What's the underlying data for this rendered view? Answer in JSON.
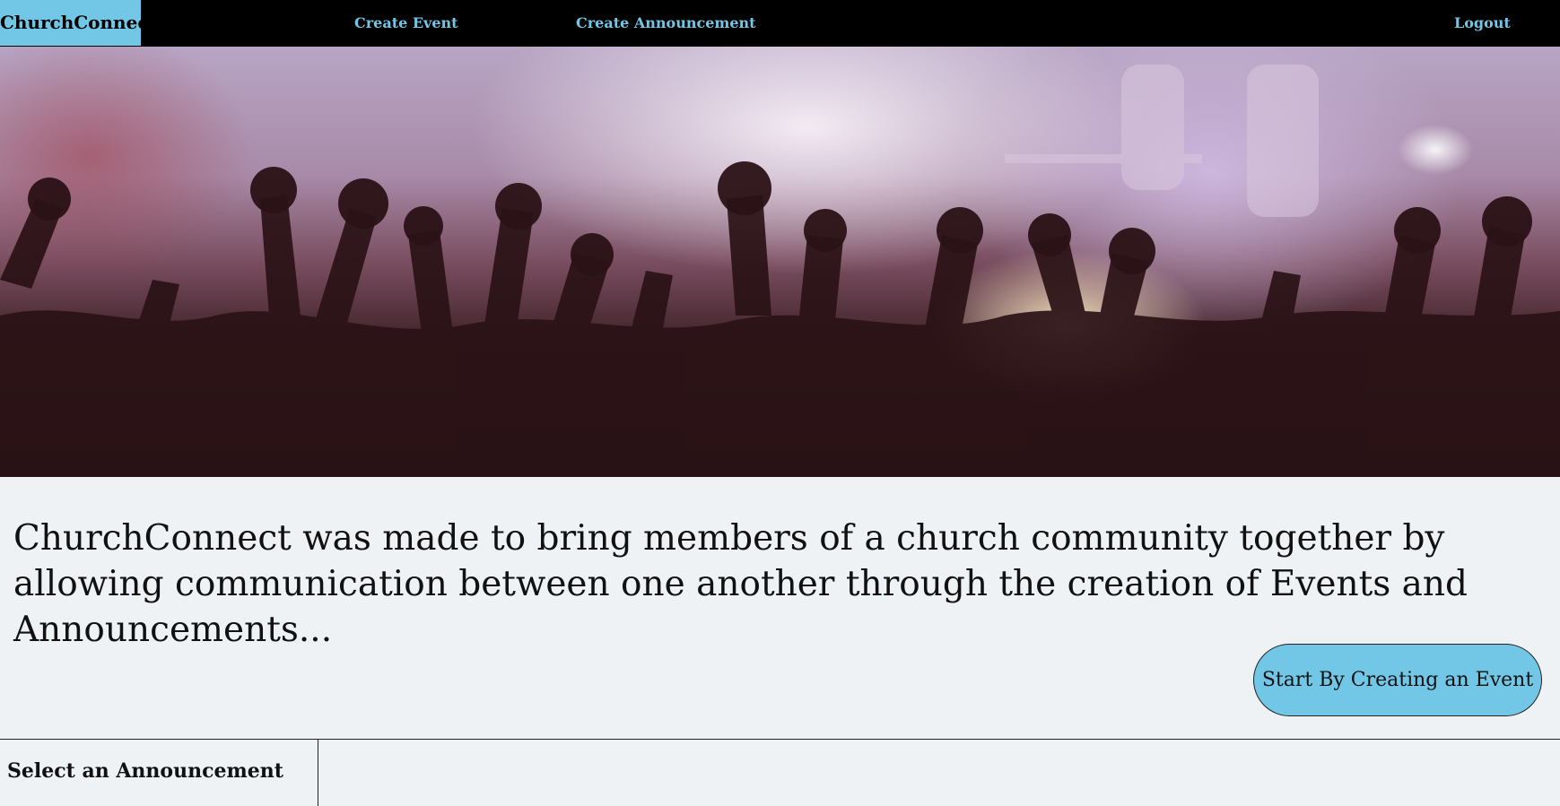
{
  "nav": {
    "brand": "ChurchConnect",
    "create_event": "Create Event",
    "create_announcement": "Create Announcement",
    "logout": "Logout"
  },
  "hero": {
    "image": "concert-crowd-raised-hands"
  },
  "intro": {
    "text": "ChurchConnect was made to bring members of a church community together by allowing communication between one another through the creation of Events and Announcements..."
  },
  "cta": {
    "label": "Start By Creating an Event"
  },
  "announcements": {
    "title": "Select an Announcement"
  },
  "colors": {
    "accent": "#72c7e6",
    "navbar": "#000000",
    "background": "#eef2f5"
  }
}
